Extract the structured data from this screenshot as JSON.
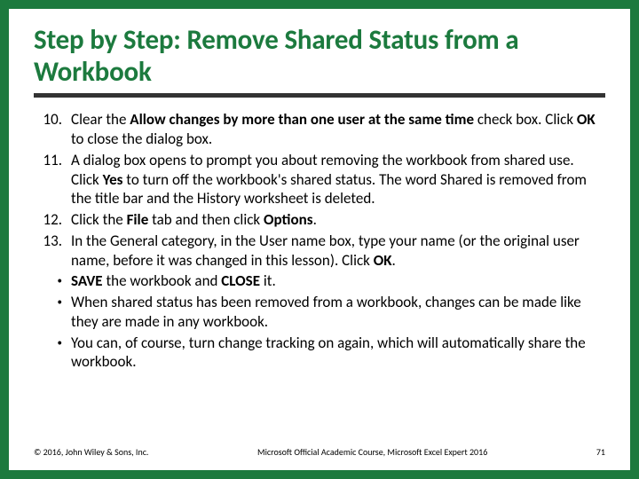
{
  "title": "Step by Step: Remove Shared Status from a Workbook",
  "items": [
    {
      "marker": "10.",
      "segments": [
        "Clear the ",
        "Allow changes by more than one user at the same time",
        " check box. Click ",
        "OK",
        " to close the dialog box."
      ]
    },
    {
      "marker": "11.",
      "segments": [
        "A dialog box opens to prompt you about removing the workbook from shared use. Click ",
        "Yes",
        " to turn off the workbook's shared status. The word Shared is removed from the title bar and the History worksheet is deleted."
      ]
    },
    {
      "marker": "12.",
      "segments": [
        "Click the ",
        "File",
        " tab and then click ",
        "Options",
        "."
      ]
    },
    {
      "marker": "13.",
      "segments": [
        "In the General category, in the User name box, type your name (or the original user name, before it was changed in this lesson). Click ",
        "OK",
        "."
      ]
    },
    {
      "marker": "•",
      "segments": [
        "",
        "SAVE",
        " the workbook and ",
        "CLOSE",
        " it."
      ]
    },
    {
      "marker": "•",
      "segments": [
        "When shared status has been removed from a workbook, changes can be made like they are made in any workbook."
      ]
    },
    {
      "marker": "•",
      "segments": [
        "You can, of course, turn change tracking on again, which will automatically share the workbook."
      ]
    }
  ],
  "footer": {
    "left": "© 2016, John Wiley & Sons, Inc.",
    "center": "Microsoft Official Academic Course, Microsoft Excel Expert 2016",
    "right": "71"
  }
}
